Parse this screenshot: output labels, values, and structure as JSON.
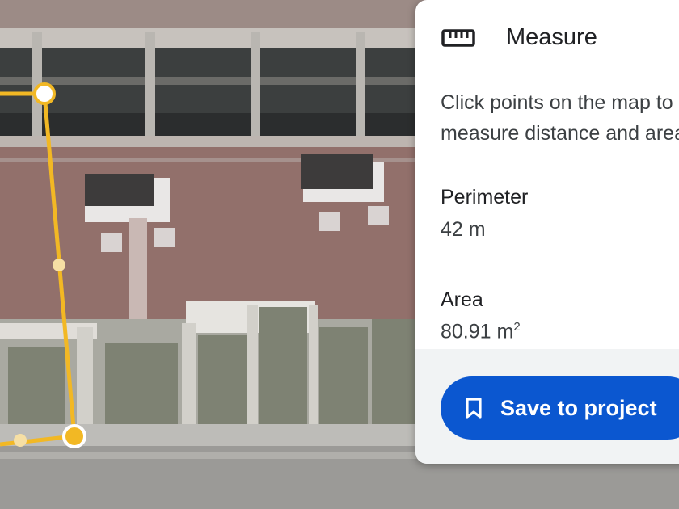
{
  "panel": {
    "title": "Measure",
    "title_icon": "ruler-icon",
    "instruction": "Click points on the map to measure distance and area",
    "perimeter_label": "Perimeter",
    "perimeter_value": "42 m",
    "area_label": "Area",
    "area_value": "80.91 m",
    "area_unit_sup": "2",
    "save_button_label": "Save to project",
    "save_button_icon": "bookmark-icon"
  },
  "colors": {
    "accent": "#0b57d0",
    "measure_line": "#f2b824"
  }
}
